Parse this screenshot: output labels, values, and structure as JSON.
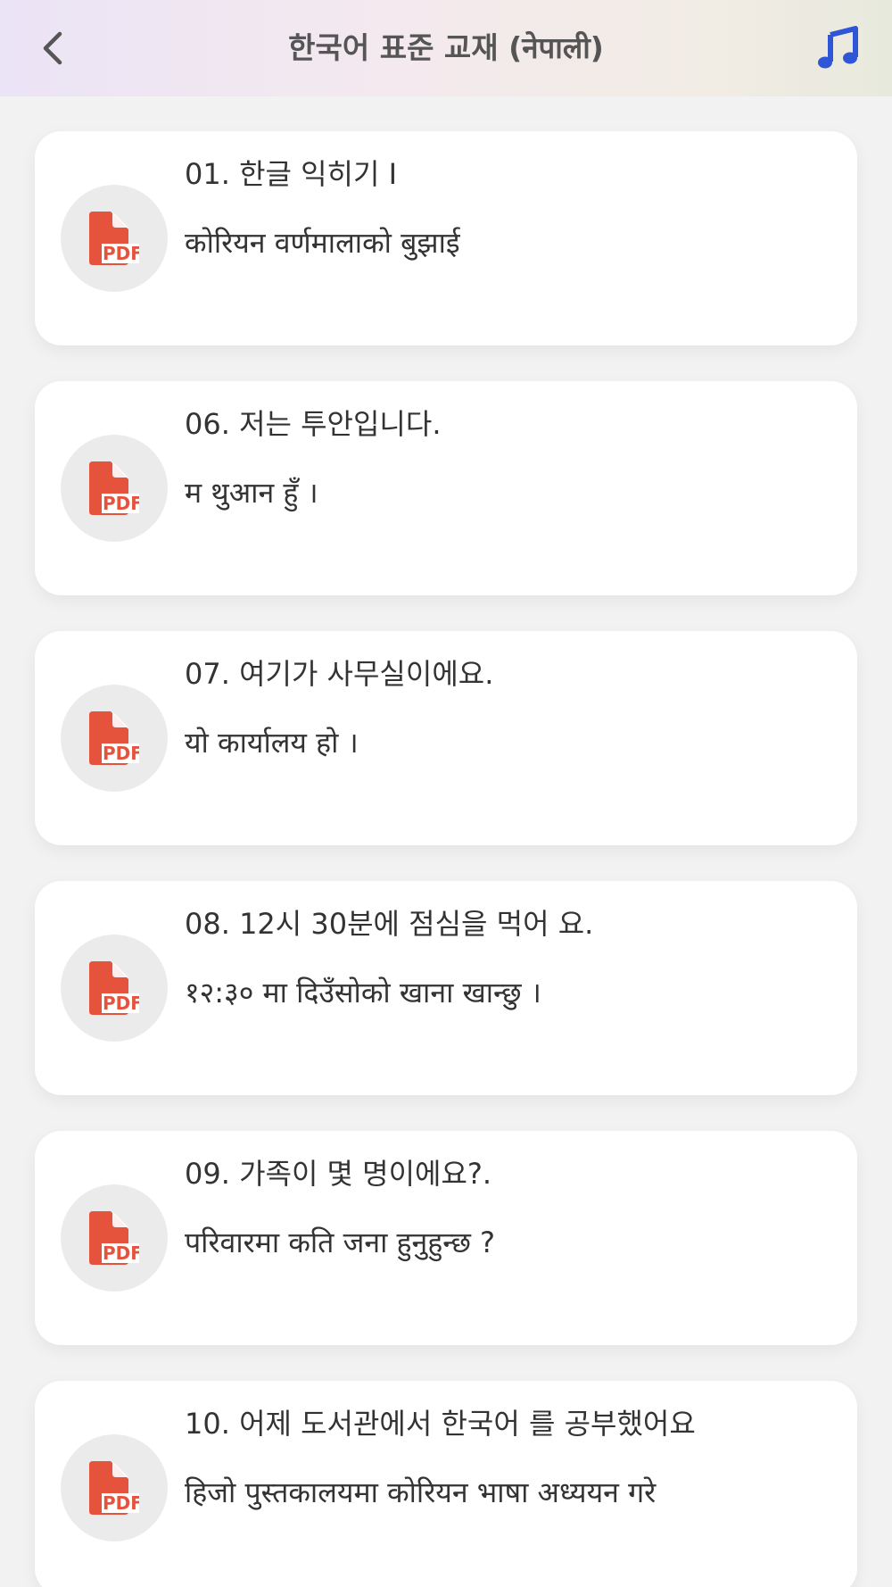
{
  "header": {
    "title": "한국어 표준 교재  (नेपाली)",
    "back_icon": "chevron-left-icon",
    "music_icon": "music-note-icon",
    "accent_color": "#2f56d6"
  },
  "lessons": [
    {
      "title": "01. 한글 익히기 Ⅰ",
      "subtitle": "कोरियन वर्णमालाको बुझाई",
      "icon": "pdf-file-icon"
    },
    {
      "title": "06. 저는 투안입니다.",
      "subtitle": "म थुआन हुँ ।",
      "icon": "pdf-file-icon"
    },
    {
      "title": "07. 여기가 사무실이에요.",
      "subtitle": "यो कार्यालय हो ।",
      "icon": "pdf-file-icon"
    },
    {
      "title": "08. 12시 30분에 점심을 먹어 요.",
      "subtitle": "१२:३० मा दिउँसोको खाना खान्छु ।",
      "icon": "pdf-file-icon"
    },
    {
      "title": "09. 가족이 몇 명이에요?.",
      "subtitle": "परिवारमा कति जना हुनुहुन्छ ?",
      "icon": "pdf-file-icon"
    },
    {
      "title": "10. 어제 도서관에서 한국어 를 공부했어요",
      "subtitle": "हिजो पुस्तकालयमा कोरियन भाषा अध्ययन गरे",
      "icon": "pdf-file-icon"
    }
  ],
  "colors": {
    "pdf_red": "#e5533d",
    "pdf_circle_bg": "#ebebeb",
    "text": "#333333"
  }
}
